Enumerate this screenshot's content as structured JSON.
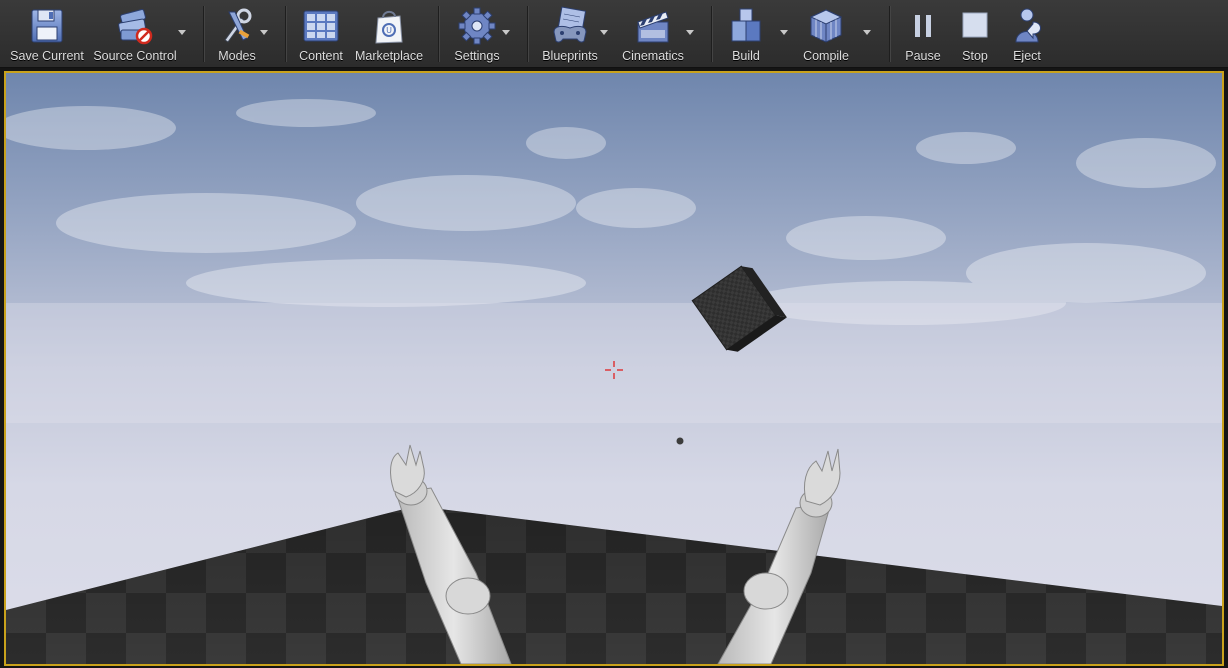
{
  "toolbar": {
    "save_current": "Save Current",
    "source_control": "Source Control",
    "modes": "Modes",
    "content": "Content",
    "marketplace": "Marketplace",
    "settings": "Settings",
    "blueprints": "Blueprints",
    "cinematics": "Cinematics",
    "build": "Build",
    "compile": "Compile",
    "pause": "Pause",
    "stop": "Stop",
    "eject": "Eject"
  },
  "viewport": {
    "border_color": "#c9a21c",
    "crosshair_color": "#e02020"
  }
}
